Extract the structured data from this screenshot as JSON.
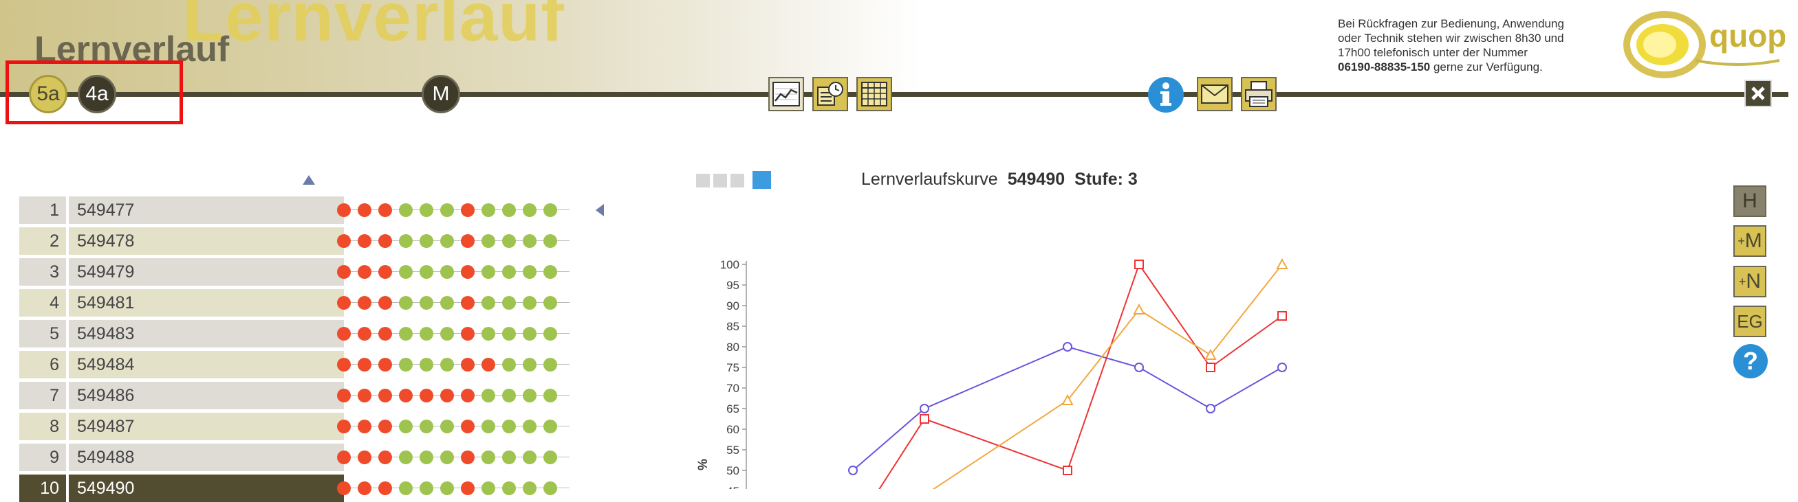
{
  "header": {
    "bg_title": "Lernverlauf",
    "title": "Lernverlauf",
    "class_buttons": [
      {
        "label": "5a"
      },
      {
        "label": "4a"
      }
    ],
    "m_button": "M",
    "support": {
      "line1": "Bei Rückfragen zur Bedienung, Anwendung",
      "line2": "oder Technik stehen wir zwischen 8h30 und",
      "line3": "17h00 telefonisch unter der Nummer",
      "phone": "06190-88835-150",
      "line4_rest": "gerne zur Verfügung."
    },
    "logo_text": "quop.",
    "icons": [
      "chart-icon",
      "schedule-icon",
      "table-icon",
      "info-icon",
      "mail-icon",
      "print-icon",
      "close-icon"
    ]
  },
  "list": {
    "rows": [
      {
        "num": "1",
        "id": "549477",
        "dots": "rrrgggrgggg"
      },
      {
        "num": "2",
        "id": "549478",
        "dots": "rrrgggrgggg"
      },
      {
        "num": "3",
        "id": "549479",
        "dots": "rrrgggrgggg"
      },
      {
        "num": "4",
        "id": "549481",
        "dots": "rrrgggrgggg"
      },
      {
        "num": "5",
        "id": "549483",
        "dots": "rrrgggrgggg"
      },
      {
        "num": "6",
        "id": "549484",
        "dots": "rrrgggrrggg"
      },
      {
        "num": "7",
        "id": "549486",
        "dots": "rrrrrrrgggg"
      },
      {
        "num": "8",
        "id": "549487",
        "dots": "rrrgggrgggg"
      },
      {
        "num": "9",
        "id": "549488",
        "dots": "rrrgggrgggg"
      },
      {
        "num": "10",
        "id": "549490",
        "dots": "rrrgggrgggg"
      }
    ],
    "selected_index": 9
  },
  "chart": {
    "heading": "Lernverlaufskurve",
    "id": "549490",
    "level": "Stufe: 3"
  },
  "chart_data": {
    "type": "line",
    "ylabel": "%",
    "yticks": [
      45,
      50,
      55,
      60,
      65,
      70,
      75,
      80,
      85,
      90,
      95,
      100
    ],
    "ylim": [
      45,
      100
    ],
    "x": [
      1,
      2,
      3,
      4,
      5,
      6,
      7,
      8,
      9,
      10
    ],
    "series": [
      {
        "color": "#6655dd",
        "marker": "circle",
        "values": [
          null,
          null,
          null,
          50,
          65,
          null,
          80,
          75,
          65,
          75
        ]
      },
      {
        "color": "#ee3333",
        "marker": "square",
        "values": [
          null,
          null,
          null,
          null,
          62.5,
          null,
          50,
          100,
          75,
          87.5
        ]
      },
      {
        "color": "#f2a840",
        "marker": "triangle",
        "values": [
          null,
          null,
          null,
          null,
          44,
          null,
          67,
          89,
          78,
          100
        ]
      }
    ]
  },
  "side": {
    "h": "H",
    "m": "M",
    "n": "N",
    "plus": "+",
    "eg": "EG",
    "help": "?"
  },
  "colors": {
    "accent": "#d8c253",
    "dark": "#4a4732",
    "red": "#ef4b2a",
    "green": "#9ec44f",
    "blue": "#2b8fd6"
  }
}
